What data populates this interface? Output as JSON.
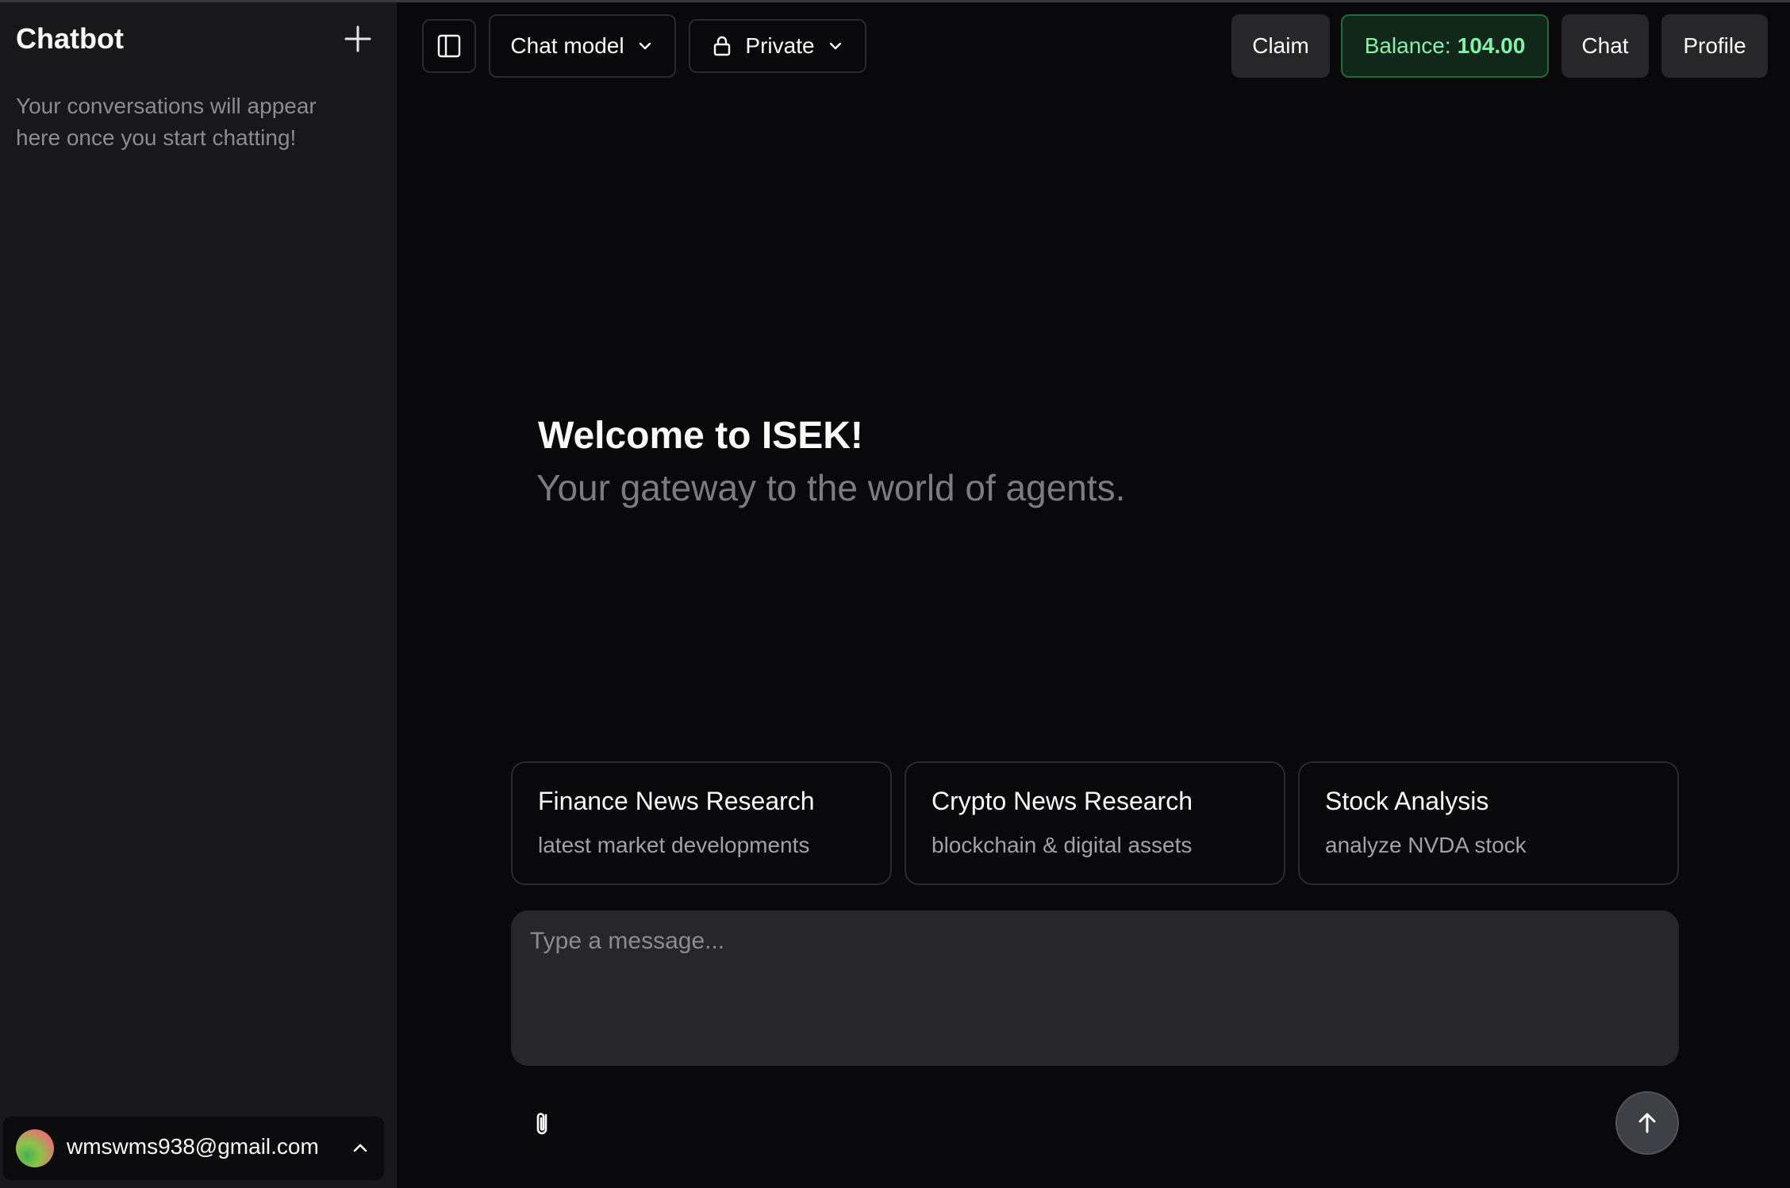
{
  "sidebar": {
    "title": "Chatbot",
    "new_chat_icon": "plus-icon",
    "empty_message": "Your conversations will appear here once you start chatting!",
    "user": {
      "email": "wmswms938@gmail.com",
      "chevron_icon": "chevron-up-icon"
    }
  },
  "header": {
    "toggle_icon": "sidebar-toggle-icon",
    "model_label": "Chat model",
    "visibility_label": "Private",
    "visibility_icon": "lock-icon",
    "claim_label": "Claim",
    "balance_label": "Balance:",
    "balance_value": "104.00",
    "chat_label": "Chat",
    "profile_label": "Profile"
  },
  "welcome": {
    "title": "Welcome to ISEK!",
    "subtitle": "Your gateway to the world of agents."
  },
  "suggestions": [
    {
      "title": "Finance News Research",
      "subtitle": "latest market developments"
    },
    {
      "title": "Crypto News Research",
      "subtitle": "blockchain & digital assets"
    },
    {
      "title": "Stock Analysis",
      "subtitle": "analyze NVDA stock"
    }
  ],
  "composer": {
    "placeholder": "Type a message...",
    "attach_icon": "paperclip-icon",
    "send_icon": "arrow-up-icon"
  },
  "colors": {
    "background": "#09090b",
    "sidebar": "#18181b",
    "balance_text": "#86efac",
    "balance_border": "#1f6b3a"
  }
}
